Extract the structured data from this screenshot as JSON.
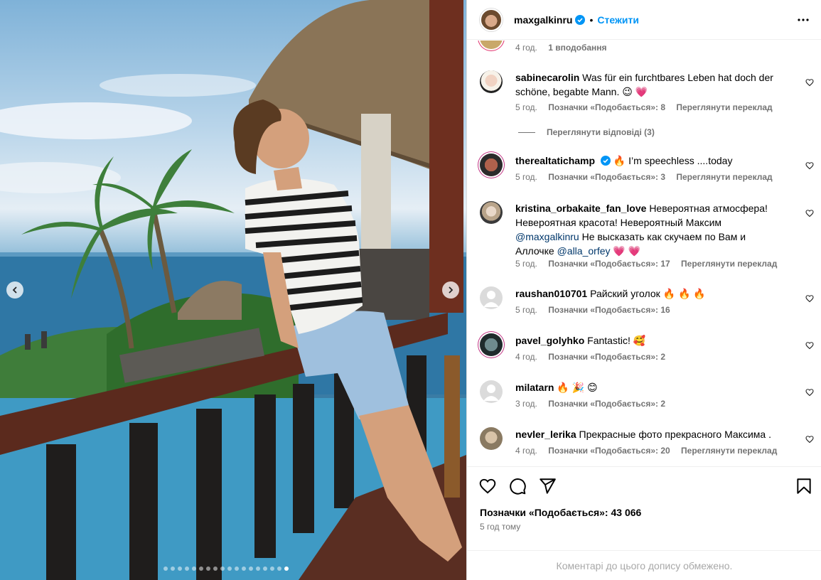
{
  "post": {
    "author": "maxgalkinru",
    "bullet": "•",
    "follow_label": "Стежити",
    "likes_label": "Позначки «Подобається»: 43 066",
    "time": "5 год тому",
    "comments_limited": "Коментарі до цього допису обмежено."
  },
  "carousel": {
    "slide_count": 18,
    "active_index": 17
  },
  "top_meta": {
    "time": "4 год.",
    "likes": "1 вподобання"
  },
  "replies_label": "Переглянути відповіді (3)",
  "comments": [
    {
      "user": "sabinecarolin",
      "text": "Was für ein furchtbares Leben hat doch der schöne, begabte Mann. 😉 💗",
      "time": "5 год.",
      "likes": "Позначки «Подобається»: 8",
      "translate": "Переглянути переклад"
    },
    {
      "user": "therealtatichamp",
      "text": "🔥 I’m speechless ....today",
      "time": "5 год.",
      "likes": "Позначки «Подобається»: 3",
      "translate": "Переглянути переклад"
    },
    {
      "user": "kristina_orbakaite_fan_love",
      "text_a": "Невероятная атмосфера! Невероятная красота! Невероятный Максим ",
      "mention_a": "@maxgalkinru",
      "text_b": " Не высказать как скучаем по Вам и Аллочке ",
      "mention_b": "@alla_orfey",
      "text_c": " 💗 💗",
      "time": "5 год.",
      "likes": "Позначки «Подобається»: 17",
      "translate": "Переглянути переклад"
    },
    {
      "user": "raushan010701",
      "text": "Райский уголок 🔥 🔥 🔥",
      "time": "5 год.",
      "likes": "Позначки «Подобається»: 16"
    },
    {
      "user": "pavel_golyhko",
      "text": "Fantastic! 🥰",
      "time": "4 год.",
      "likes": "Позначки «Подобається»: 2"
    },
    {
      "user": "milatarn",
      "text": "🔥 🎉 😊",
      "time": "3 год.",
      "likes": "Позначки «Подобається»: 2"
    },
    {
      "user": "nevler_lerika",
      "text": "Прекрасные фото прекрасного Максима .",
      "time": "4 год.",
      "likes": "Позначки «Подобається»: 20",
      "translate": "Переглянути переклад"
    }
  ],
  "icons": [
    "verified-icon",
    "more-icon",
    "heart-icon",
    "comment-icon",
    "share-icon",
    "bookmark-icon",
    "chevron-left-icon",
    "chevron-right-icon"
  ],
  "colors": {
    "link": "#0095f6",
    "mention": "#00376b",
    "muted": "#737373",
    "border": "#dbdbdb"
  }
}
